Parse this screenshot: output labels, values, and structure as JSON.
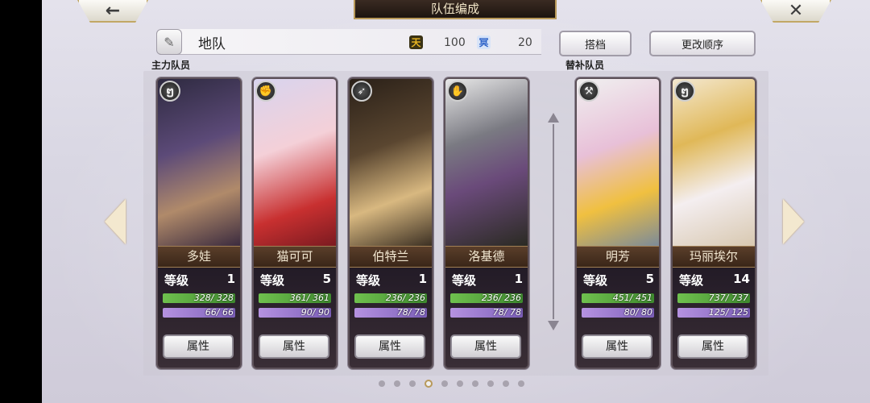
{
  "title": "队伍编成",
  "nav": {
    "back_icon": "←",
    "close_icon": "✕"
  },
  "team": {
    "edit_icon": "pencil-icon",
    "name": "地队",
    "sky_cost_icon": "天",
    "sky_cost": "100",
    "earth_cost_icon": "冥",
    "earth_cost": "20"
  },
  "buttons": {
    "partner": "搭档",
    "change_order": "更改顺序"
  },
  "sections": {
    "main": "主力队员",
    "sub": "替补队员"
  },
  "level_label": "等级",
  "attr_label": "属性",
  "members": [
    {
      "name": "多娃",
      "type_icon": "ໆ",
      "level": "1",
      "hp": "328/ 328",
      "mp": "66/ 66"
    },
    {
      "name": "猫可可",
      "type_icon": "✊",
      "level": "5",
      "hp": "361/ 361",
      "mp": "90/ 90"
    },
    {
      "name": "伯特兰",
      "type_icon": "➶",
      "level": "1",
      "hp": "236/ 236",
      "mp": "78/ 78"
    },
    {
      "name": "洛基德",
      "type_icon": "✋",
      "level": "1",
      "hp": "236/ 236",
      "mp": "78/ 78"
    },
    {
      "name": "明芳",
      "type_icon": "⚒",
      "level": "5",
      "hp": "451/ 451",
      "mp": "80/ 80"
    },
    {
      "name": "玛丽埃尔",
      "type_icon": "ໆ",
      "level": "14",
      "hp": "737/ 737",
      "mp": "125/ 125"
    }
  ],
  "pagination": {
    "total": 10,
    "active": 3
  },
  "colors": {
    "gold_border": "#b8995a",
    "hp": "#6fc04e",
    "mp": "#b592e0"
  }
}
